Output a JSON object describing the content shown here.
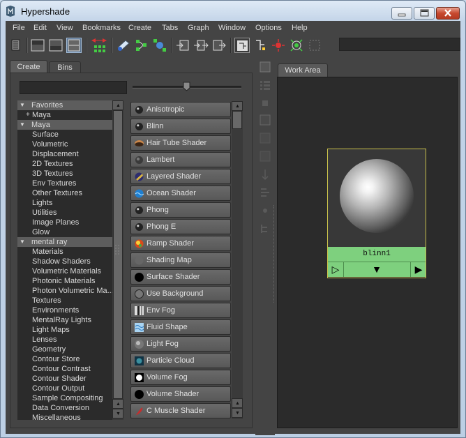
{
  "window": {
    "title": "Hypershade"
  },
  "menu": [
    "File",
    "Edit",
    "View",
    "Bookmarks",
    "Create",
    "Tabs",
    "Graph",
    "Window",
    "Options",
    "Help"
  ],
  "left_tabs": {
    "create": "Create",
    "bins": "Bins"
  },
  "work_tab": "Work Area",
  "tree": [
    {
      "label": "Favorites",
      "type": "head",
      "arrow": "▼"
    },
    {
      "label": "Maya",
      "type": "child",
      "plus": "+"
    },
    {
      "label": "Maya",
      "type": "head",
      "arrow": "▼"
    },
    {
      "label": "Surface",
      "type": "child"
    },
    {
      "label": "Volumetric",
      "type": "child"
    },
    {
      "label": "Displacement",
      "type": "child"
    },
    {
      "label": "2D Textures",
      "type": "child"
    },
    {
      "label": "3D Textures",
      "type": "child"
    },
    {
      "label": "Env Textures",
      "type": "child"
    },
    {
      "label": "Other Textures",
      "type": "child"
    },
    {
      "label": "Lights",
      "type": "child"
    },
    {
      "label": "Utilities",
      "type": "child"
    },
    {
      "label": "Image Planes",
      "type": "child"
    },
    {
      "label": "Glow",
      "type": "child"
    },
    {
      "label": "mental ray",
      "type": "head",
      "arrow": "▼"
    },
    {
      "label": "Materials",
      "type": "child"
    },
    {
      "label": "Shadow Shaders",
      "type": "child"
    },
    {
      "label": "Volumetric Materials",
      "type": "child"
    },
    {
      "label": "Photonic Materials",
      "type": "child"
    },
    {
      "label": "Photon Volumetric Ma...",
      "type": "child"
    },
    {
      "label": "Textures",
      "type": "child"
    },
    {
      "label": "Environments",
      "type": "child"
    },
    {
      "label": "MentalRay Lights",
      "type": "child"
    },
    {
      "label": "Light Maps",
      "type": "child"
    },
    {
      "label": "Lenses",
      "type": "child"
    },
    {
      "label": "Geometry",
      "type": "child"
    },
    {
      "label": "Contour Store",
      "type": "child"
    },
    {
      "label": "Contour Contrast",
      "type": "child"
    },
    {
      "label": "Contour Shader",
      "type": "child"
    },
    {
      "label": "Contour Output",
      "type": "child"
    },
    {
      "label": "Sample Compositing",
      "type": "child"
    },
    {
      "label": "Data Conversion",
      "type": "child"
    },
    {
      "label": "Miscellaneous",
      "type": "child"
    }
  ],
  "shaders": [
    {
      "label": "Anisotropic",
      "icon": "sphere-dark-icon"
    },
    {
      "label": "Blinn",
      "icon": "sphere-dark-icon"
    },
    {
      "label": "Hair Tube Shader",
      "icon": "hair-tube-icon"
    },
    {
      "label": "Lambert",
      "icon": "sphere-grey-icon"
    },
    {
      "label": "Layered Shader",
      "icon": "layered-icon"
    },
    {
      "label": "Ocean Shader",
      "icon": "ocean-icon"
    },
    {
      "label": "Phong",
      "icon": "sphere-dark-icon"
    },
    {
      "label": "Phong E",
      "icon": "sphere-dark-icon"
    },
    {
      "label": "Ramp Shader",
      "icon": "ramp-icon"
    },
    {
      "label": "Shading Map",
      "icon": "shading-map-icon"
    },
    {
      "label": "Surface Shader",
      "icon": "surface-shader-icon"
    },
    {
      "label": "Use Background",
      "icon": "use-background-icon"
    },
    {
      "label": "Env Fog",
      "icon": "env-fog-icon"
    },
    {
      "label": "Fluid Shape",
      "icon": "fluid-shape-icon"
    },
    {
      "label": "Light Fog",
      "icon": "light-fog-icon"
    },
    {
      "label": "Particle Cloud",
      "icon": "particle-cloud-icon"
    },
    {
      "label": "Volume Fog",
      "icon": "volume-fog-icon"
    },
    {
      "label": "Volume Shader",
      "icon": "volume-shader-icon"
    },
    {
      "label": "C Muscle Shader",
      "icon": "muscle-icon"
    }
  ],
  "swatch": {
    "name": "blinn1",
    "left_glyph": "▷",
    "mid_glyph": "▼",
    "right_glyph": "▶"
  },
  "scroll": {
    "up": "▲",
    "down": "▼"
  },
  "colors": {
    "panel": "#444444",
    "field": "#2b2b2b",
    "swatch_label": "#7ed07e",
    "swatch_border": "#c8c04a",
    "selection": "#5d5d5d"
  }
}
